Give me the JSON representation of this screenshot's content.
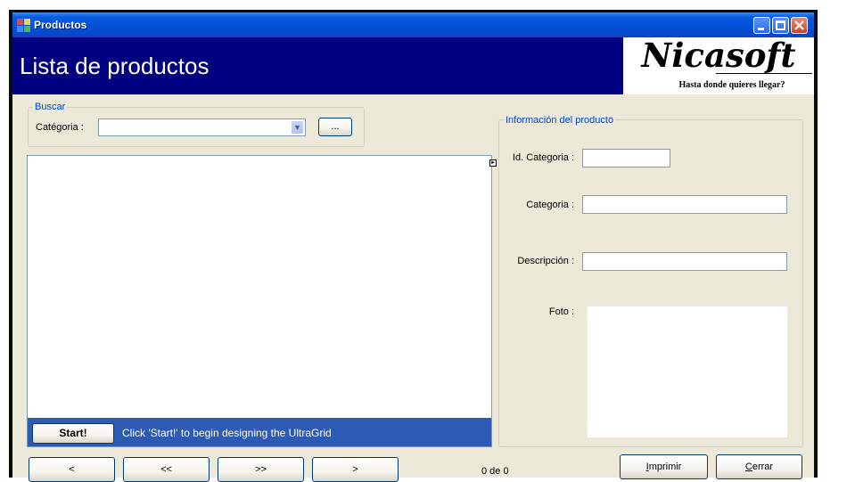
{
  "window": {
    "title": "Productos",
    "colors": {
      "titlebar": "#0250d6",
      "header": "#000080",
      "client": "#ece9d8",
      "legend": "#0046d5",
      "grid_bar": "#2d5bb3"
    }
  },
  "header": {
    "title": "Lista de productos",
    "logo_text": "Nicasoft",
    "logo_tagline": "Hasta donde quieres llegar?"
  },
  "search": {
    "group_label": "Buscar",
    "category_label": "Catégoria :",
    "category_value": "",
    "browse_label": "..."
  },
  "grid": {
    "start_label": "Start!",
    "message": "Click 'Start!' to begin designing the UltraGrid"
  },
  "product_info": {
    "group_label": "Información del producto",
    "id_label": "Id. Categoria :",
    "id_value": "",
    "category_label": "Categoria :",
    "category_value": "",
    "description_label": "Descripción :",
    "description_value": "",
    "photo_label": "Foto :"
  },
  "navigation": {
    "prev": "<",
    "first": "<<",
    "last": ">>",
    "next": ">",
    "record_status": "0 de 0"
  },
  "actions": {
    "print_mnemonic": "I",
    "print_rest": "mprimir",
    "close_mnemonic": "C",
    "close_rest": "errar"
  }
}
